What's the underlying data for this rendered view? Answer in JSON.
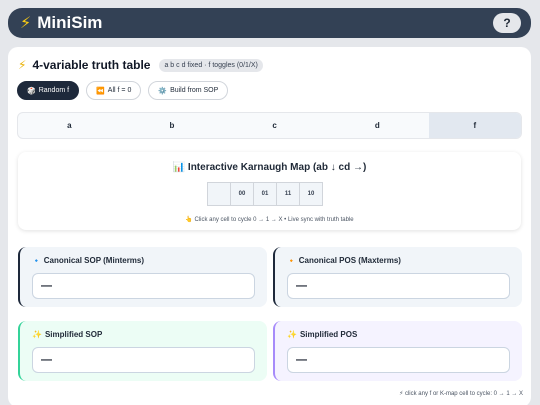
{
  "header": {
    "icon": "lightning-bolt-icon",
    "title": "MiniSim",
    "help_label": "?"
  },
  "truth_table": {
    "title": "4-variable truth table",
    "badge": "a b c d fixed · f toggles (0/1/X)",
    "buttons": [
      {
        "icon": "🎲",
        "label": "Random f"
      },
      {
        "icon": "⏪",
        "label": "All f = 0"
      },
      {
        "icon": "⚙️",
        "label": "Build from SOP"
      }
    ],
    "columns": [
      "a",
      "b",
      "c",
      "d",
      "f"
    ]
  },
  "kmap": {
    "icon": "📊",
    "title": "Interactive Karnaugh Map (ab ↓ cd →)",
    "columns": [
      "00",
      "01",
      "11",
      "10"
    ],
    "hint": "👆 Click any cell to cycle 0 → 1 → X • Live sync with truth table"
  },
  "canonical_sop": {
    "icon": "🔹",
    "label": "Canonical SOP (Minterms)",
    "value": "—"
  },
  "canonical_pos": {
    "icon": "🔸",
    "label": "Canonical POS (Maxterms)",
    "value": "—"
  },
  "simplified_sop": {
    "icon": "✨",
    "label": "Simplified SOP",
    "value": "—"
  },
  "simplified_pos": {
    "icon": "✨",
    "label": "Simplified POS",
    "value": "—"
  },
  "footer_hint": "⚡ click any f or K-map cell to cycle: 0 → 1 → X"
}
